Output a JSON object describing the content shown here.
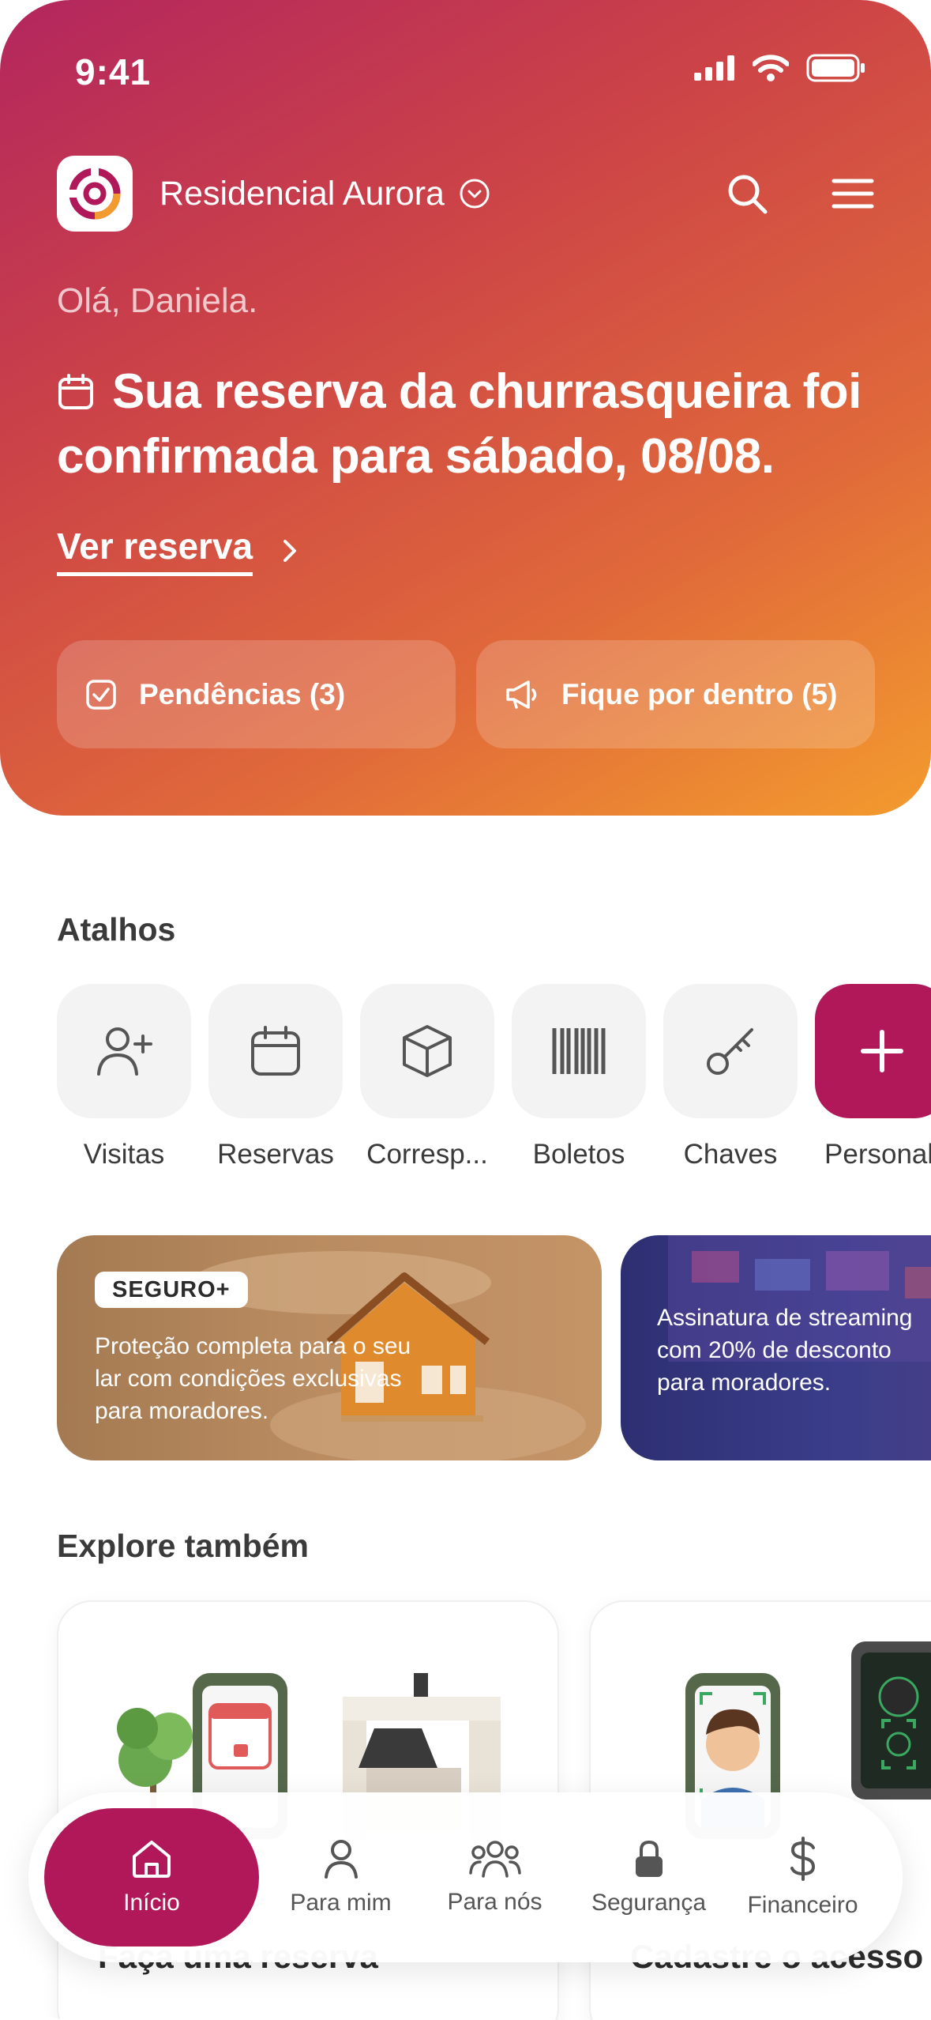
{
  "status_bar": {
    "time": "9:41"
  },
  "header": {
    "condo_name": "Residencial Aurora"
  },
  "hero": {
    "greeting": "Olá, Daniela.",
    "headline": "Sua reserva da churrasqueira foi confirmada para sábado, 08/08.",
    "link_label": "Ver reserva",
    "chips": [
      {
        "label": "Pendências (3)",
        "icon": "checkbox-icon"
      },
      {
        "label": "Fique por dentro (5)",
        "icon": "megaphone-icon"
      }
    ]
  },
  "shortcuts": {
    "title": "Atalhos",
    "items": [
      {
        "label": "Visitas",
        "icon": "add-person-icon"
      },
      {
        "label": "Reservas",
        "icon": "calendar-icon"
      },
      {
        "label": "Corresp...",
        "icon": "package-icon"
      },
      {
        "label": "Boletos",
        "icon": "barcode-icon"
      },
      {
        "label": "Chaves",
        "icon": "key-icon"
      },
      {
        "label": "Personali",
        "icon": "plus-icon"
      }
    ]
  },
  "banners": [
    {
      "tag": "SEGURO+",
      "text": "Proteção completa para o seu lar com condições exclusivas para moradores."
    },
    {
      "text": "Assinatura de streaming com 20% de desconto para moradores."
    }
  ],
  "explore": {
    "title": "Explore também",
    "cards": [
      {
        "title": "Faça uma reserva"
      },
      {
        "title": "Cadastre o acesso"
      }
    ]
  },
  "bottom_nav": {
    "items": [
      {
        "label": "Início",
        "icon": "home-icon",
        "active": true
      },
      {
        "label": "Para mim",
        "icon": "person-icon"
      },
      {
        "label": "Para nós",
        "icon": "group-icon"
      },
      {
        "label": "Segurança",
        "icon": "lock-icon"
      },
      {
        "label": "Financeiro",
        "icon": "dollar-icon"
      }
    ]
  },
  "colors": {
    "brand": "#b0185a",
    "hero_start": "#b3265e",
    "hero_end": "#f39b2e"
  }
}
